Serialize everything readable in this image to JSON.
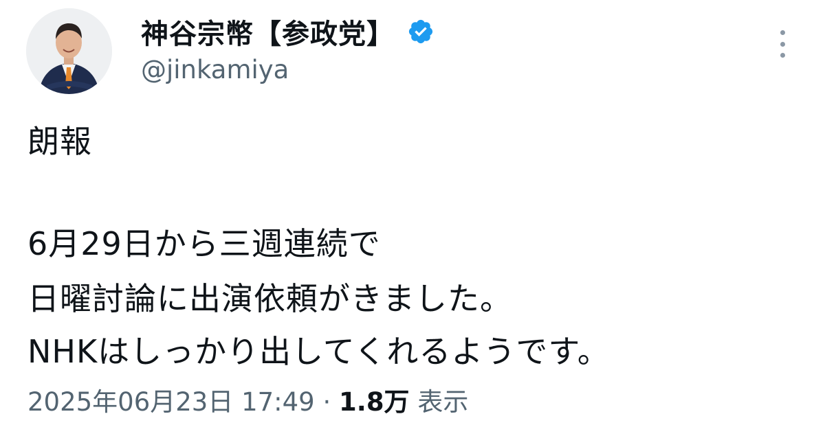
{
  "author": {
    "display_name": "神谷宗幣【参政党】",
    "handle": "@jinkamiya",
    "verified": true
  },
  "tweet": {
    "line1": "朗報",
    "line2": "6月29日から三週連続で",
    "line3": "日曜討論に出演依頼がきました。",
    "line4": "NHKはしっかり出してくれるようです。"
  },
  "meta": {
    "date_time": "2025年06月23日 17:49",
    "separator": "·",
    "views_count": "1.8万",
    "views_label": "表示"
  },
  "icons": {
    "verified": "verified-badge-icon",
    "more": "more-vertical-icon"
  },
  "colors": {
    "verified_blue": "#1d9bf0",
    "text_primary": "#0f1419",
    "text_secondary": "#536471"
  }
}
